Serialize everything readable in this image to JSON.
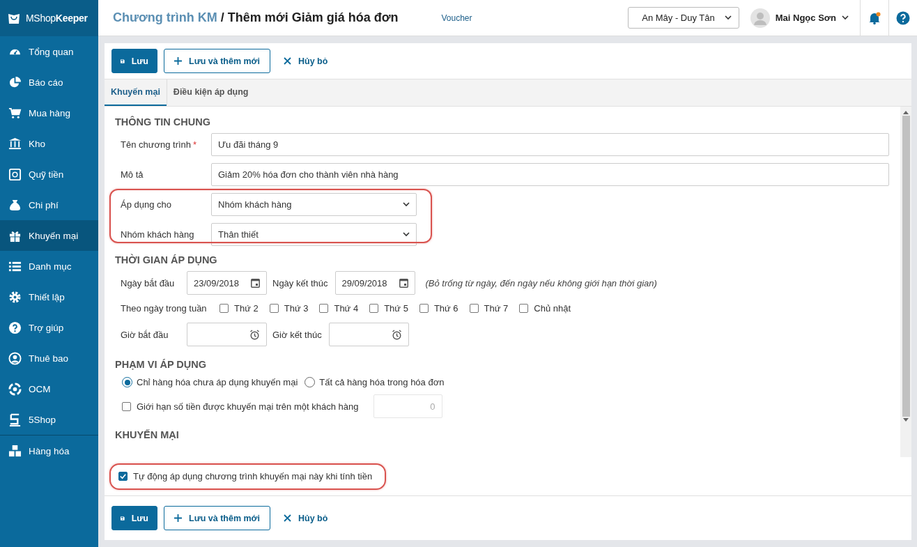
{
  "sidebar": {
    "logo": "MShop**Keeper**",
    "items": [
      {
        "label": "Tổng quan",
        "selected": false
      },
      {
        "label": "Báo cáo",
        "selected": false
      },
      {
        "label": "Mua hàng",
        "selected": false
      },
      {
        "label": "Kho",
        "selected": false
      },
      {
        "label": "Quỹ tiền",
        "selected": false
      },
      {
        "label": "Chi phí",
        "selected": false
      },
      {
        "label": "Khuyến mại",
        "selected": true
      },
      {
        "label": "Danh mục",
        "selected": false
      },
      {
        "label": "Thiết lập",
        "selected": false
      },
      {
        "label": "Trợ giúp",
        "selected": false
      },
      {
        "label": "Thuê bao",
        "selected": false
      },
      {
        "label": "OCM",
        "selected": false
      },
      {
        "label": "5Shop",
        "selected": false
      }
    ],
    "bottom_item": {
      "label": "Hàng hóa",
      "selected": false
    }
  },
  "header": {
    "breadcrumb_parent": "Chương trình KM",
    "separator": "/",
    "title": "Thêm mới Giảm giá hóa đơn",
    "voucher": "Voucher",
    "store": "An Mây - Duy Tân",
    "user": "Mai Ngọc Sơn",
    "notification": true
  },
  "toolbar_top": [
    {
      "kind": "primary",
      "label": "Lưu"
    },
    {
      "kind": "outline",
      "label": "Lưu và thêm mới"
    },
    {
      "kind": "text",
      "label": "Hủy bỏ"
    }
  ],
  "tabs": [
    {
      "label": "Khuyến mại",
      "selected": true
    },
    {
      "label": "Điều kiện áp dụng",
      "selected": false
    }
  ],
  "general": {
    "heading": "THÔNG TIN CHUNG",
    "name": {
      "label": "Tên chương trình",
      "required_mark": "*",
      "value": "Ưu đãi tháng 9"
    },
    "description": {
      "label": "Mô tả",
      "value": "Giảm 20% hóa đơn cho thành viên nhà hàng"
    },
    "apply_to": {
      "label": "Áp dụng cho",
      "value": "Nhóm khách hàng"
    },
    "customer_group": {
      "label": "Nhóm khách hàng",
      "value": "Thân thiết"
    }
  },
  "time": {
    "heading": "THỜI GIAN ÁP DỤNG",
    "start_date": {
      "label": "Ngày bắt đầu",
      "value": "23/09/2018"
    },
    "end_date": {
      "label": "Ngày kết thúc",
      "value": "29/09/2018"
    },
    "note": "(Bỏ trống từ ngày, đến ngày nếu không giới hạn thời gian)",
    "weekdays_label": "Theo ngày trong tuần",
    "weekdays": [
      {
        "label": "Thứ 2",
        "checked": false
      },
      {
        "label": "Thứ 3",
        "checked": false
      },
      {
        "label": "Thứ 4",
        "checked": false
      },
      {
        "label": "Thứ 5",
        "checked": false
      },
      {
        "label": "Thứ 6",
        "checked": false
      },
      {
        "label": "Thứ 7",
        "checked": false
      },
      {
        "label": "Chủ nhật",
        "checked": false
      }
    ],
    "start_time": {
      "label": "Giờ bắt đầu"
    },
    "end_time": {
      "label": "Giờ kết thúc"
    }
  },
  "scope": {
    "heading": "PHẠM VI ÁP DỤNG",
    "options": [
      {
        "label": "Chỉ hàng hóa chưa áp dụng khuyến mại",
        "selected": true
      },
      {
        "label": "Tất cả hàng hóa trong hóa đơn",
        "selected": false
      }
    ],
    "limit": {
      "label": "Giới hạn số tiền được khuyến mại trên một khách hàng",
      "checked": false,
      "value": "0",
      "disabled": true
    }
  },
  "promotion": {
    "heading": "KHUYẾN MẠI",
    "auto_apply": {
      "label": "Tự động áp dụng chương trình khuyến mại này khi tính tiền",
      "checked": true
    }
  },
  "toolbar_bottom": [
    {
      "kind": "primary",
      "label": "Lưu"
    },
    {
      "kind": "outline",
      "label": "Lưu và thêm mới"
    },
    {
      "kind": "text",
      "label": "Hủy bỏ"
    }
  ]
}
